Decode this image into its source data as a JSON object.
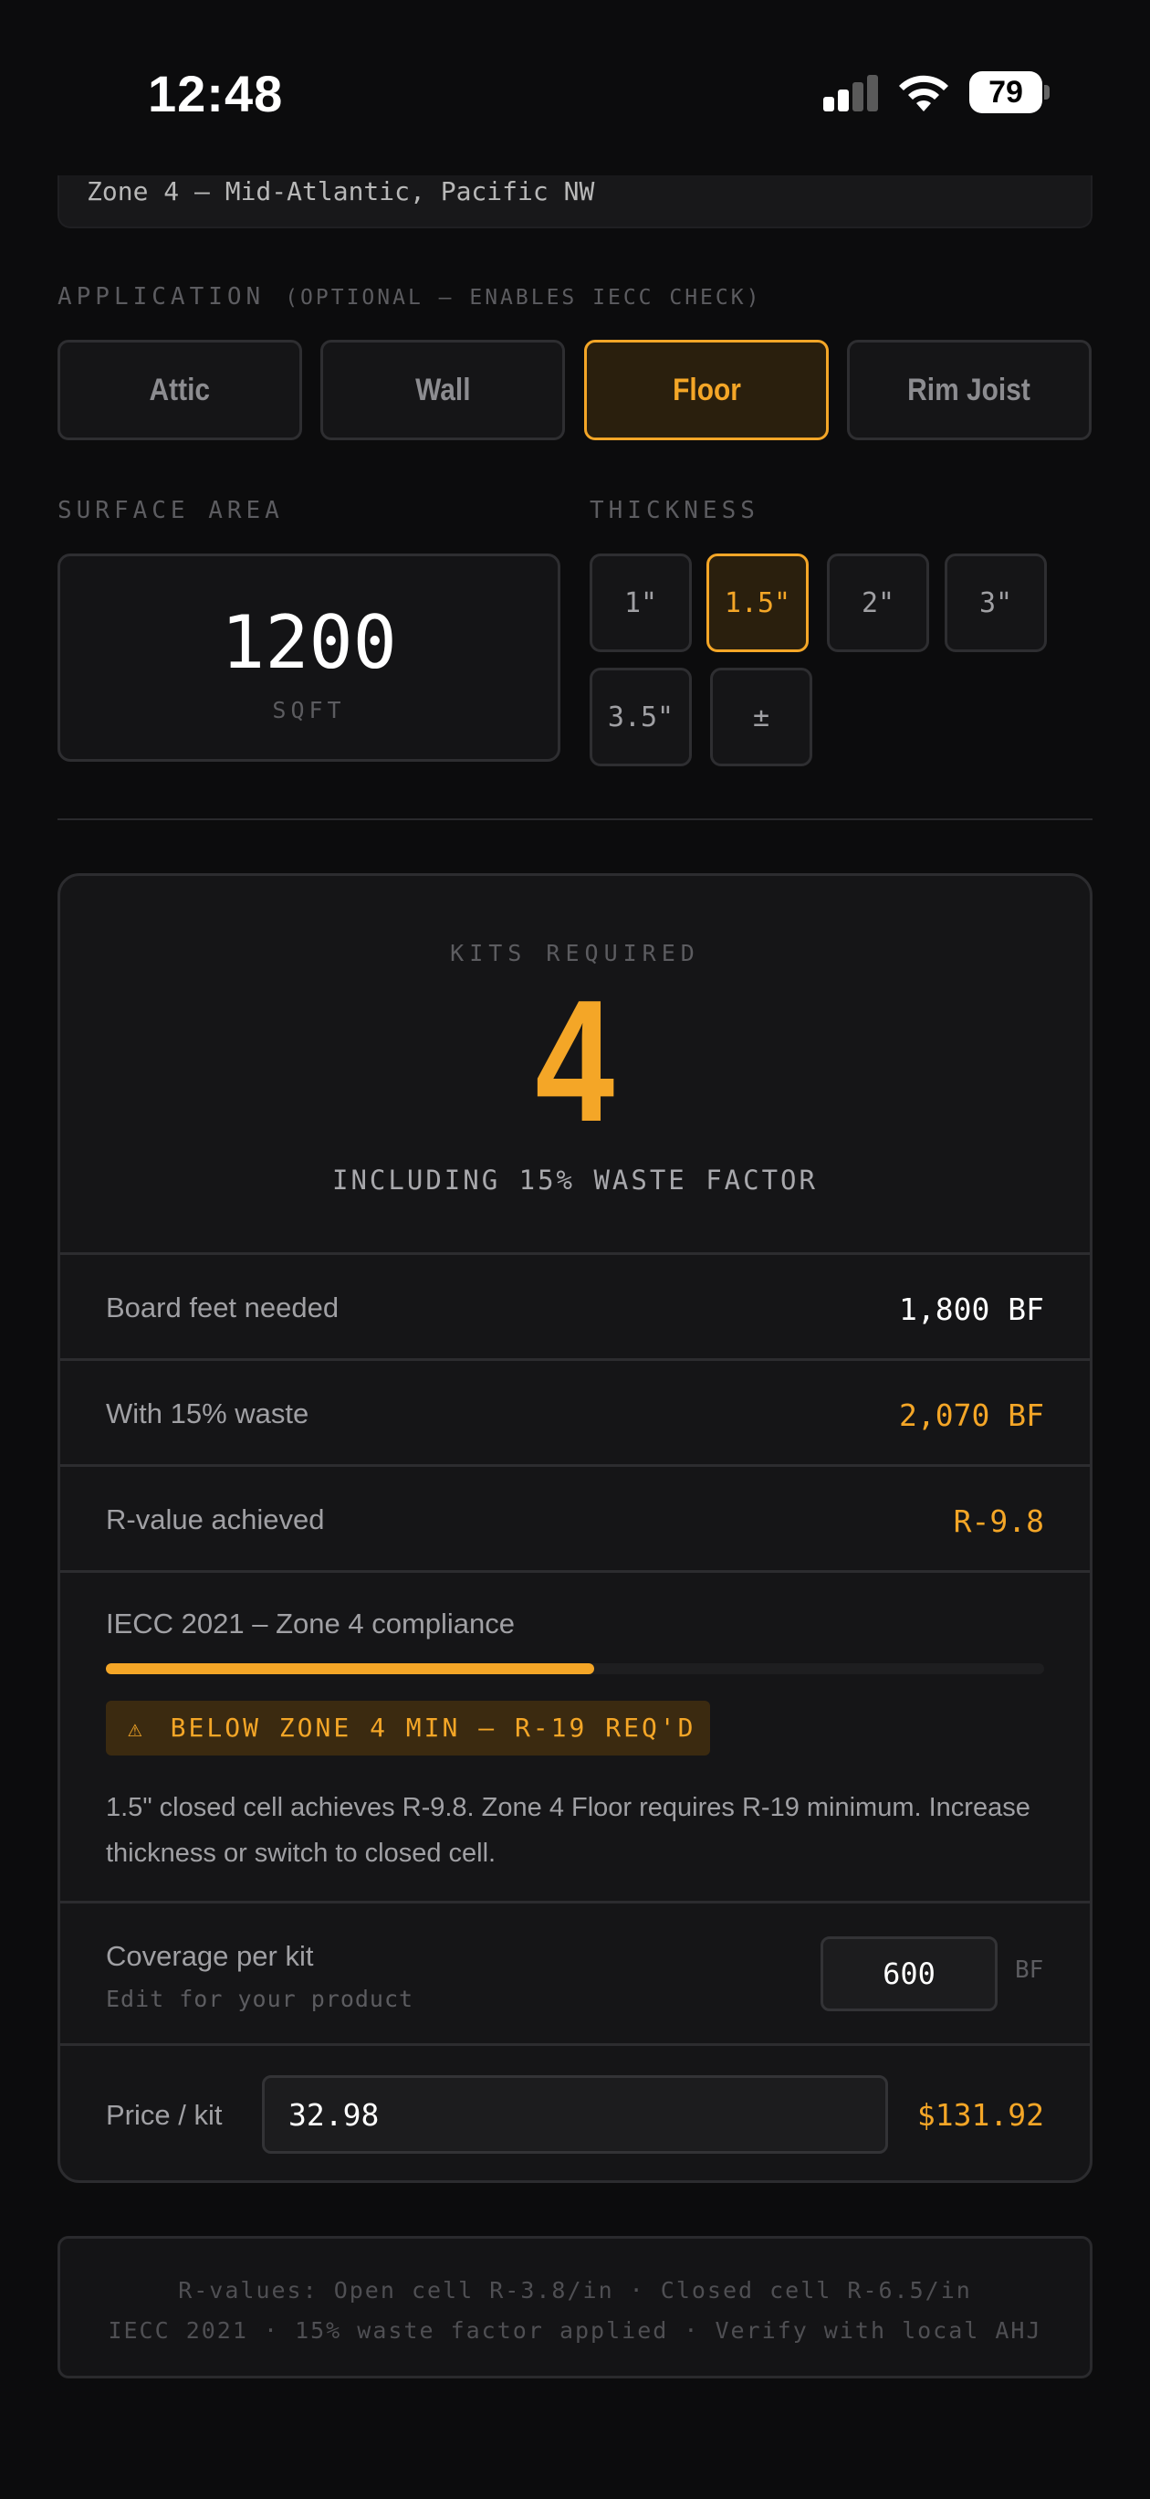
{
  "status_bar": {
    "time": "12:48",
    "battery": "79"
  },
  "zone": {
    "selected": "Zone 4 – Mid-Atlantic, Pacific NW"
  },
  "application": {
    "label": "APPLICATION",
    "sublabel": "(OPTIONAL – ENABLES IECC CHECK)",
    "options": [
      "Attic",
      "Wall",
      "Floor",
      "Rim Joist"
    ],
    "selected": "Floor"
  },
  "surface_area": {
    "label": "SURFACE AREA",
    "value": "1200",
    "unit": "SQFT"
  },
  "thickness": {
    "label": "THICKNESS",
    "options": [
      "1\"",
      "1.5\"",
      "2\"",
      "3\"",
      "3.5\"",
      "±"
    ],
    "selected": "1.5\""
  },
  "results": {
    "kits_label": "KITS REQUIRED",
    "kits_value": "4",
    "kits_note": "INCLUDING 15% WASTE FACTOR",
    "board_feet_label": "Board feet needed",
    "board_feet_value": "1,800 BF",
    "with_waste_label": "With 15% waste",
    "with_waste_value": "2,070 BF",
    "r_value_label": "R-value achieved",
    "r_value_value": "R-9.8"
  },
  "compliance": {
    "title": "IECC 2021 – Zone 4 compliance",
    "progress": 0.52,
    "badge_icon": "warning-icon",
    "badge_text": "BELOW ZONE 4 MIN – R-19 REQ'D",
    "message": "1.5\" closed cell achieves R-9.8. Zone 4 Floor requires R-19 minimum. Increase thickness or switch to closed cell."
  },
  "coverage": {
    "label": "Coverage per kit",
    "sublabel": "Edit for your product",
    "value": "600",
    "unit": "BF"
  },
  "price": {
    "label": "Price / kit",
    "value": "32.98",
    "total": "$131.92"
  },
  "notes": {
    "line1": "R-values: Open cell R-3.8/in · Closed cell R-6.5/in",
    "line2": "IECC 2021 · 15% waste factor applied · Verify with local AHJ"
  },
  "colors": {
    "accent": "#f4a627",
    "background": "#0c0c0d",
    "card": "#151517"
  }
}
